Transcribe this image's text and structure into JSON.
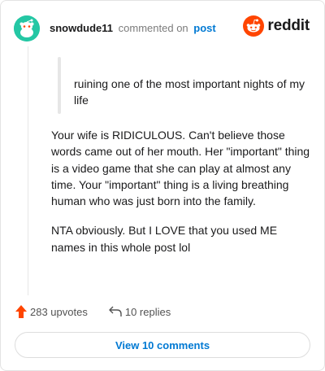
{
  "comment": {
    "username": "snowdude11",
    "action_text": "commented on",
    "post_link": "post"
  },
  "brand": {
    "logo_text": "reddit",
    "accent": "#ff4500"
  },
  "quote": {
    "text": "ruining one of the most important nights of my life"
  },
  "body": {
    "paragraphs": [
      "Your wife is RIDICULOUS. Can't believe those words came out of her mouth. Her \"important\" thing is a video game that she can play at almost any time. Your \"important\" thing is a living breathing human who was just born into the family.",
      "NTA obviously. But I LOVE that you used ME names in this whole post lol"
    ]
  },
  "actions": {
    "upvotes": "283 upvotes",
    "replies": "10 replies",
    "upvote_color": "#ff4500"
  },
  "footer": {
    "view_comments": "View 10 comments"
  },
  "icons": [
    "reddit-avatar-icon",
    "reddit-logo-icon",
    "upvote-arrow-icon",
    "reply-icon"
  ]
}
